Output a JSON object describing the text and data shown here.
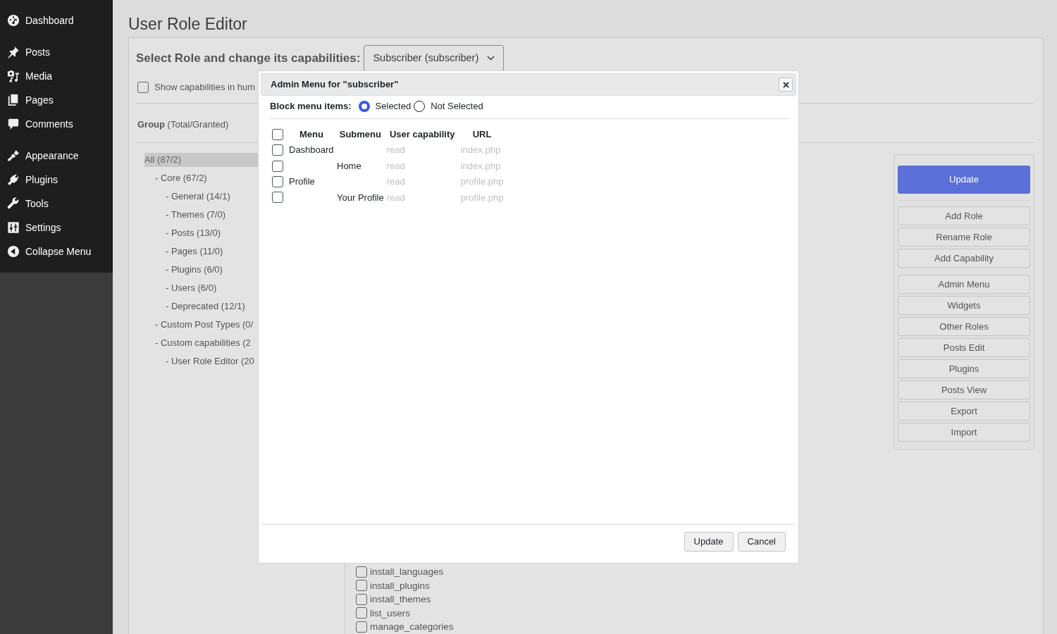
{
  "sidebar": {
    "groups": [
      [
        "Dashboard"
      ],
      [
        "Posts",
        "Media",
        "Pages",
        "Comments"
      ],
      [
        "Appearance",
        "Plugins",
        "Tools",
        "Settings",
        "Collapse Menu"
      ]
    ]
  },
  "page": {
    "title": "User Role Editor"
  },
  "role_selector": {
    "label": "Select Role and change its capabilities:",
    "value": "Subscriber (subscriber)"
  },
  "show_human_readable": {
    "label": "Show capabilities in hum",
    "checked": false
  },
  "group_header": "**Group** (Total/Granted)",
  "group_tree": [
    {
      "label": "All (87/2)",
      "selected": true,
      "children": [
        {
          "label": "- Core (67/2)",
          "selected": false,
          "children": [
            {
              "label": "- General (14/1)",
              "selected": false
            },
            {
              "label": "- Themes (7/0)",
              "selected": false
            },
            {
              "label": "- Posts (13/0)",
              "selected": false
            },
            {
              "label": "- Pages (11/0)",
              "selected": false
            },
            {
              "label": "- Plugins (6/0)",
              "selected": false
            },
            {
              "label": "- Users (6/0)",
              "selected": false
            },
            {
              "label": "- Deprecated (12/1)",
              "selected": false
            }
          ]
        },
        {
          "label": "- Custom Post Types (0/",
          "selected": false
        },
        {
          "label": "- Custom capabilities (2",
          "selected": false,
          "children": [
            {
              "label": "- User Role Editor (20",
              "selected": false
            }
          ]
        }
      ]
    }
  ],
  "capabilities": [
    {
      "label": "install_languages",
      "checked": false
    },
    {
      "label": "install_plugins",
      "checked": false
    },
    {
      "label": "install_themes",
      "checked": false
    },
    {
      "label": "list_users",
      "checked": false
    },
    {
      "label": "manage_categories",
      "checked": false
    }
  ],
  "action_groups": [
    [
      {
        "label": "Update",
        "kind": "primary"
      }
    ],
    [
      {
        "label": "Add Role",
        "kind": "secondary"
      },
      {
        "label": "Rename Role",
        "kind": "secondary"
      },
      {
        "label": "Add Capability",
        "kind": "secondary"
      }
    ],
    [
      {
        "label": "Admin Menu",
        "kind": "secondary"
      },
      {
        "label": "Widgets",
        "kind": "secondary"
      },
      {
        "label": "Other Roles",
        "kind": "secondary"
      },
      {
        "label": "Posts Edit",
        "kind": "secondary"
      },
      {
        "label": "Plugins",
        "kind": "secondary"
      },
      {
        "label": "Posts View",
        "kind": "secondary"
      },
      {
        "label": "Export",
        "kind": "secondary"
      },
      {
        "label": "Import",
        "kind": "secondary"
      }
    ]
  ],
  "dialog": {
    "title": "Admin Menu for \"subscriber\"",
    "block_label": "Block menu items:",
    "block_options": [
      {
        "label": "Selected",
        "selected": true
      },
      {
        "label": "Not Selected",
        "selected": false
      }
    ],
    "table": {
      "select_all_checked": false,
      "columns": [
        "Menu",
        "Submenu",
        "User capability",
        "URL"
      ],
      "rows": [
        {
          "kind": "menu",
          "label": "Dashboard",
          "capability": "read",
          "url": "index.php",
          "checked": false
        },
        {
          "kind": "submenu",
          "label": "Home",
          "capability": "read",
          "url": "index.php",
          "checked": false
        },
        {
          "kind": "menu",
          "label": "Profile",
          "capability": "read",
          "url": "profile.php",
          "checked": false
        },
        {
          "kind": "submenu",
          "label": "Your Profile",
          "capability": "read",
          "url": "profile.php",
          "checked": false
        }
      ]
    },
    "buttons": [
      "Update",
      "Cancel"
    ]
  }
}
